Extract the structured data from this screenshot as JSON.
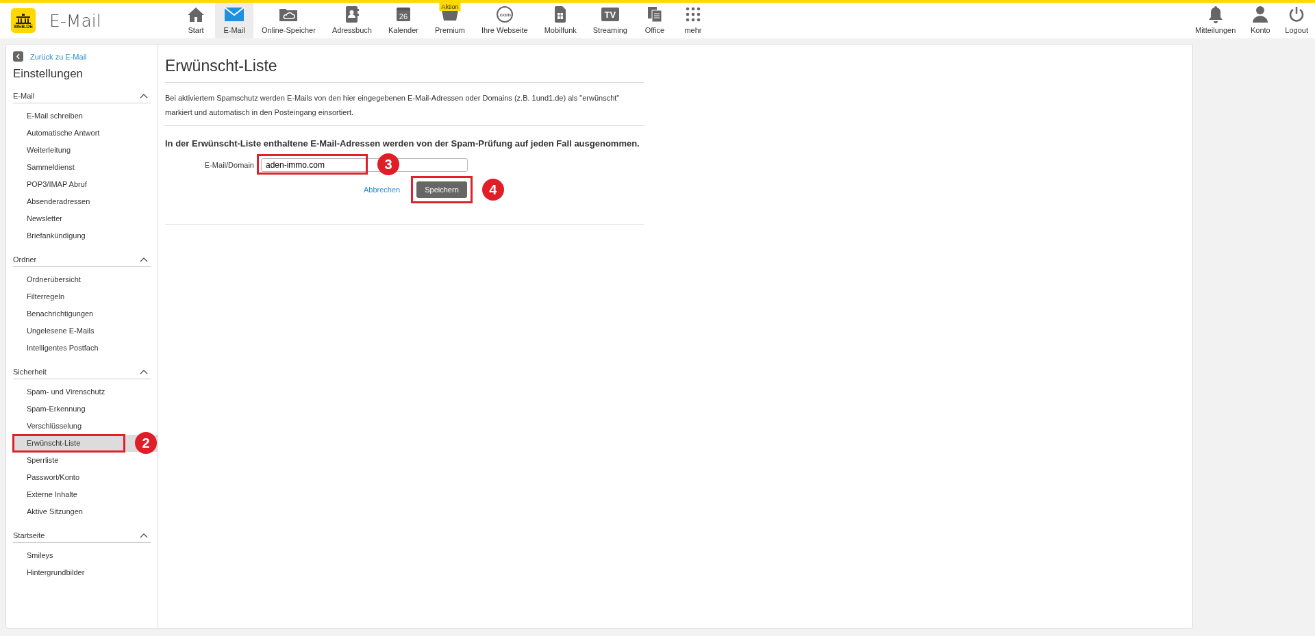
{
  "header": {
    "logo_text": "WEB.DE",
    "app_title": "E-Mail",
    "nav": [
      {
        "label": "Start",
        "kind": "home",
        "selected": false
      },
      {
        "label": "E-Mail",
        "kind": "mail",
        "selected": true
      },
      {
        "label": "Online-Speicher",
        "kind": "cloud",
        "selected": false
      },
      {
        "label": "Adressbuch",
        "kind": "contacts",
        "selected": false
      },
      {
        "label": "Kalender",
        "kind": "calendar",
        "icon_text": "26",
        "selected": false
      },
      {
        "label": "Premium",
        "kind": "basket",
        "badge": "Aktion",
        "selected": false
      },
      {
        "label": "Ihre Webseite",
        "kind": "globe",
        "icon_text": ".com",
        "selected": false
      },
      {
        "label": "Mobilfunk",
        "kind": "sim",
        "selected": false
      },
      {
        "label": "Streaming",
        "kind": "tv",
        "icon_text": "TV",
        "selected": false
      },
      {
        "label": "Office",
        "kind": "office",
        "selected": false
      },
      {
        "label": "mehr",
        "kind": "grid",
        "selected": false
      }
    ],
    "right": [
      {
        "label": "Mitteilungen",
        "kind": "bell"
      },
      {
        "label": "Konto",
        "kind": "person"
      },
      {
        "label": "Logout",
        "kind": "power"
      }
    ]
  },
  "sidebar": {
    "back_link": "Zurück zu E-Mail",
    "title": "Einstellungen",
    "sections": [
      {
        "title": "E-Mail",
        "expanded": true,
        "items": [
          {
            "label": "E-Mail schreiben",
            "selected": false
          },
          {
            "label": "Automatische Antwort",
            "selected": false
          },
          {
            "label": "Weiterleitung",
            "selected": false
          },
          {
            "label": "Sammeldienst",
            "selected": false
          },
          {
            "label": "POP3/IMAP Abruf",
            "selected": false
          },
          {
            "label": "Absenderadressen",
            "selected": false
          },
          {
            "label": "Newsletter",
            "selected": false
          },
          {
            "label": "Briefankündigung",
            "selected": false
          }
        ]
      },
      {
        "title": "Ordner",
        "expanded": true,
        "items": [
          {
            "label": "Ordnerübersicht",
            "selected": false
          },
          {
            "label": "Filterregeln",
            "selected": false
          },
          {
            "label": "Benachrichtigungen",
            "selected": false
          },
          {
            "label": "Ungelesene E-Mails",
            "selected": false
          },
          {
            "label": "Intelligentes Postfach",
            "selected": false
          }
        ]
      },
      {
        "title": "Sicherheit",
        "expanded": true,
        "items": [
          {
            "label": "Spam- und Virenschutz",
            "selected": false
          },
          {
            "label": "Spam-Erkennung",
            "selected": false
          },
          {
            "label": "Verschlüsselung",
            "selected": false
          },
          {
            "label": "Erwünscht-Liste",
            "selected": true,
            "callout": "2"
          },
          {
            "label": "Sperrliste",
            "selected": false
          },
          {
            "label": "Passwort/Konto",
            "selected": false
          },
          {
            "label": "Externe Inhalte",
            "selected": false
          },
          {
            "label": "Aktive Sitzungen",
            "selected": false
          }
        ]
      },
      {
        "title": "Startseite",
        "expanded": true,
        "items": [
          {
            "label": "Smileys",
            "selected": false
          },
          {
            "label": "Hintergrundbilder",
            "selected": false
          }
        ]
      }
    ]
  },
  "main": {
    "title": "Erwünscht-Liste",
    "description": "Bei aktiviertem Spamschutz werden E-Mails von den hier eingegebenen E-Mail-Adressen oder Domains (z.B. 1und1.de) als \"erwünscht\" markiert und automatisch in den Posteingang einsortiert.",
    "notice": "In der Erwünscht-Liste enthaltene E-Mail-Adressen werden von der Spam-Prüfung auf jeden Fall ausgenommen.",
    "field": {
      "label": "E-Mail/Domain",
      "value": "aden-immo.com",
      "callout": "3"
    },
    "cancel": "Abbrechen",
    "save": {
      "label": "Speichern",
      "callout": "4"
    }
  }
}
